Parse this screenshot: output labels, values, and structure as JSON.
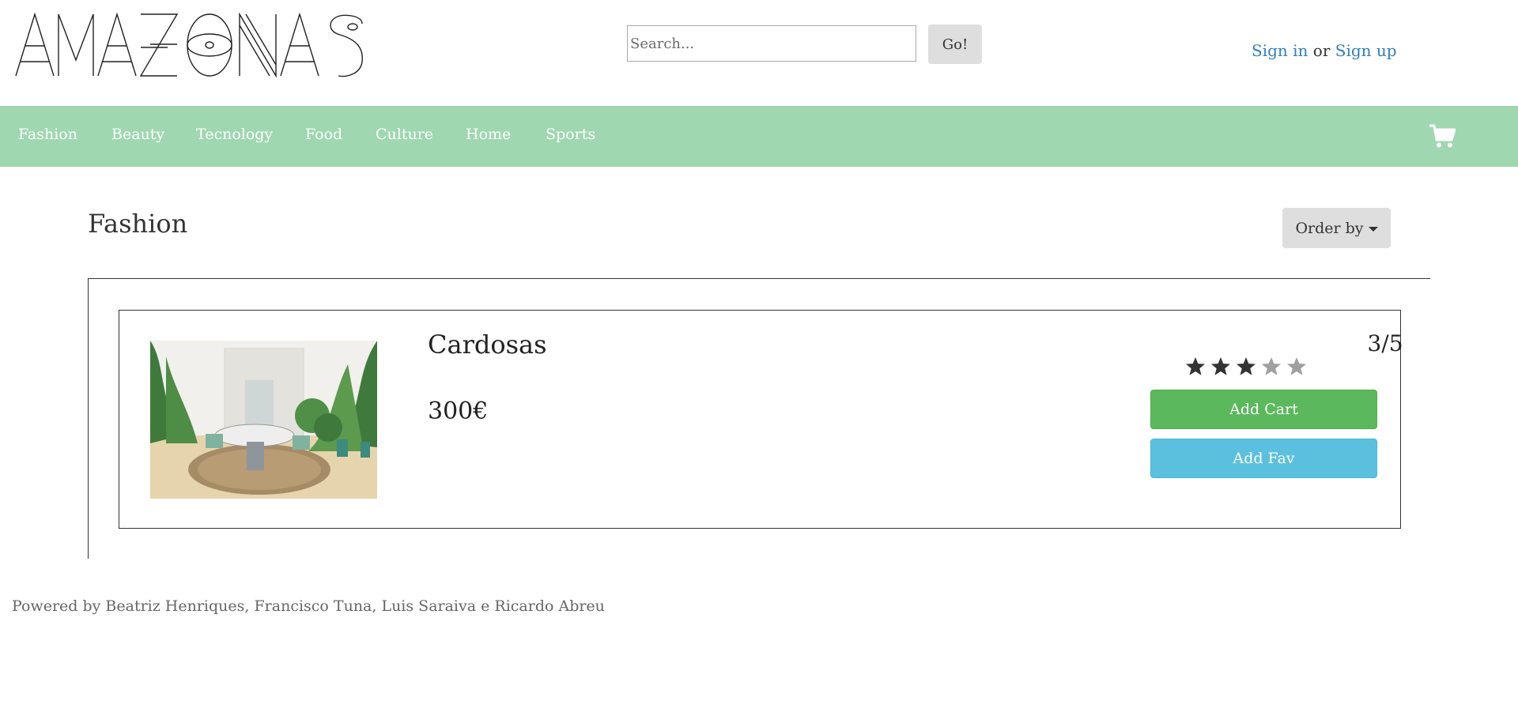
{
  "header": {
    "logo_text": "AMAZONAS",
    "search": {
      "placeholder": "Search...",
      "value": "",
      "button_label": "Go!"
    },
    "auth": {
      "sign_in": "Sign in",
      "or": "or",
      "sign_up": "Sign up"
    }
  },
  "nav": {
    "items": [
      "Fashion",
      "Beauty",
      "Tecnology",
      "Food",
      "Culture",
      "Home",
      "Sports"
    ],
    "cart_icon": "shopping-cart-icon"
  },
  "main": {
    "title": "Fashion",
    "order_label": "Order by",
    "products": [
      {
        "name": "Cardosas",
        "price": "300€",
        "rating_text": "3/5",
        "rating": 3,
        "rating_max": 5,
        "add_cart_label": "Add Cart",
        "add_fav_label": "Add Fav"
      }
    ]
  },
  "footer": {
    "text": "Powered by Beatriz Henriques, Francisco Tuna, Luis Saraiva e Ricardo Abreu"
  },
  "colors": {
    "nav_bg": "#9fd7b0",
    "link": "#2f7fc0",
    "add_cart": "#5cb85c",
    "add_fav": "#5bc0de",
    "star_filled": "#333333",
    "star_empty": "#a0a0a0"
  }
}
